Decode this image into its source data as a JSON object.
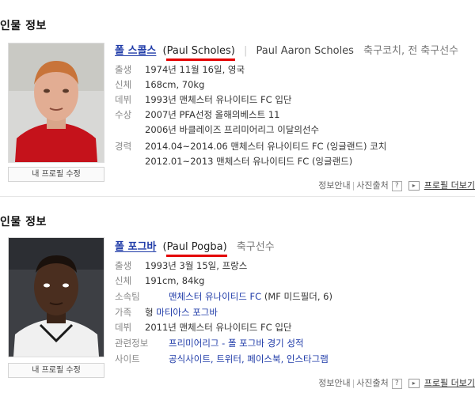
{
  "cards": [
    {
      "section_title": "인물 정보",
      "name_ko": "폴 스콜스",
      "name_en_short": "Paul Scholes",
      "name_en_full": "Paul Aaron Scholes",
      "job": "축구코치, 전 축구선수",
      "edit_profile": "내 프로필 수정",
      "rows": [
        {
          "label": "출생",
          "value": "1974년 11월 16일, 영국"
        },
        {
          "label": "신체",
          "value": "168cm, 70kg"
        },
        {
          "label": "데뷔",
          "value": "1993년 맨체스터 유나이티드 FC 입단"
        },
        {
          "label": "수상",
          "value": "2007년 PFA선정 올해의베스트 11"
        },
        {
          "label": "",
          "value": "2006년 바클레이즈 프리미어리그 이달의선수"
        },
        {
          "label": "경력",
          "value": "2014.04~2014.06 맨체스터 유나이티드 FC (잉글랜드) 코치"
        },
        {
          "label": "",
          "value": "2012.01~2013 맨체스터 유나이티드 FC (잉글랜드)"
        }
      ],
      "footer": {
        "info": "정보안내",
        "photo": "사진출처",
        "q": "?",
        "more": "프로필 더보기"
      }
    },
    {
      "section_title": "인물 정보",
      "name_ko": "폴 포그바",
      "name_en_short": "Paul Pogba",
      "job": "축구선수",
      "edit_profile": "내 프로필 수정",
      "rows": [
        {
          "label": "출생",
          "value": "1993년 3월 15일, 프랑스"
        },
        {
          "label": "신체",
          "value": "191cm, 84kg"
        },
        {
          "label": "소속팀",
          "value": "맨체스터 유나이티드 FC",
          "extra": "(MF 미드필더, 6)"
        },
        {
          "label": "가족",
          "prefix": "형",
          "value": "마티아스 포그바"
        },
        {
          "label": "데뷔",
          "value": "2011년 맨체스터 유나이티드 FC 입단"
        },
        {
          "label": "관련정보",
          "value": "프리미어리그 - 폴 포그바 경기 성적"
        },
        {
          "label": "사이트",
          "value": "공식사이트, 트위터, 페이스북, 인스타그램"
        }
      ],
      "footer": {
        "info": "정보안내",
        "photo": "사진출처",
        "q": "?",
        "more": "프로필 더보기"
      }
    }
  ],
  "colors": {
    "accent_underline": "#e40000",
    "link": "#1f3ba8"
  }
}
